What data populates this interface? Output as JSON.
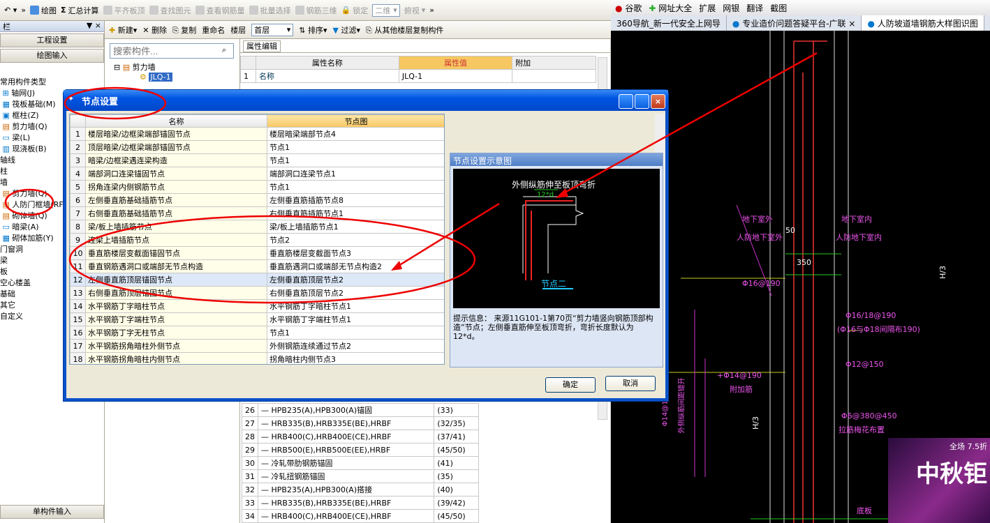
{
  "toolbar": {
    "draw": "绘图",
    "sum": "汇总计算",
    "flat": "平齐板顶",
    "find": "查找图元",
    "view_rebar": "查看钢筋量",
    "batch": "批量选择",
    "rebar3d": "钢筋三维",
    "lock": "锁定",
    "view_mode": "二维",
    "view_angle": "俯视"
  },
  "sidebar": {
    "title": "栏",
    "pin": "▼ ×",
    "btn1": "工程设置",
    "btn2": "绘图输入",
    "bottom": "单构件输入",
    "items": [
      "常用构件类型",
      "轴网(J)",
      "筏板基础(M)",
      "框柱(Z)",
      "剪力墙(Q)",
      "梁(L)",
      "现浇板(B)",
      "轴线",
      "柱",
      "墙",
      "剪力墙(Q)",
      "人防门框墙(RF)",
      "砌体墙(Q)",
      "暗梁(A)",
      "砌体加筋(Y)",
      "门窗洞",
      "梁",
      "板",
      "空心楼盖",
      "基础",
      "其它",
      "自定义"
    ]
  },
  "comp_toolbar": {
    "new": "新建",
    "del": "删除",
    "copy": "复制",
    "rename": "重命名",
    "floor_label": "楼层",
    "floor": "首层",
    "sort": "排序",
    "filter": "过滤",
    "copy_from": "从其他楼层复制构件"
  },
  "search": {
    "placeholder": "搜索构件..."
  },
  "comp_tree": {
    "root": "剪力墙",
    "child": "JLQ-1"
  },
  "prop": {
    "tab": "属性编辑",
    "h_name": "属性名称",
    "h_val": "属性值",
    "h_add": "附加",
    "r1_no": "1",
    "r1_name": "名称",
    "r1_val": "JLQ-1",
    "rows": [
      [
        "26",
        "HPB235(A),HPB300(A)锚固",
        "(33)"
      ],
      [
        "27",
        "HRB335(B),HRB335E(BE),HRBF",
        "(32/35)"
      ],
      [
        "28",
        "HRB400(C),HRB400E(CE),HRBF",
        "(37/41)"
      ],
      [
        "29",
        "HRB500(E),HRB500E(EE),HRBF",
        "(45/50)"
      ],
      [
        "30",
        "冷轧带肋钢筋锚固",
        "(41)"
      ],
      [
        "31",
        "冷轧扭钢筋锚固",
        "(35)"
      ],
      [
        "32",
        "HPB235(A),HPB300(A)搭接",
        "(40)"
      ],
      [
        "33",
        "HRB335(B),HRB335E(BE),HRBF",
        "(39/42)"
      ],
      [
        "34",
        "HRB400(C),HRB400E(CE),HRBF",
        "(45/50)"
      ]
    ]
  },
  "browser": {
    "bar": [
      "谷歌",
      "网址大全",
      "扩展",
      "网银",
      "翻译",
      "截图"
    ],
    "tabs": [
      "360导航_新一代安全上网导",
      "专业造价问题答疑平台-广联",
      "人防坡道墙钢筋大样图识图"
    ]
  },
  "dialog": {
    "title": "节点设置",
    "h_name": "名称",
    "h_node": "节点图",
    "rows": [
      [
        "1",
        "楼层暗梁/边框梁端部锚固节点",
        "楼层暗梁端部节点4"
      ],
      [
        "2",
        "顶层暗梁/边框梁端部锚固节点",
        "节点1"
      ],
      [
        "3",
        "暗梁/边框梁遇连梁构造",
        "节点1"
      ],
      [
        "4",
        "端部洞口连梁锚固节点",
        "端部洞口连梁节点1"
      ],
      [
        "5",
        "拐角连梁内侧钢筋节点",
        "节点1"
      ],
      [
        "6",
        "左侧垂直筋基础插筋节点",
        "左侧垂直筋插筋节点8"
      ],
      [
        "7",
        "右侧垂直筋基础插筋节点",
        "右侧垂直筋插筋节点1"
      ],
      [
        "8",
        "梁/板上墙插筋节点",
        "梁/板上墙插筋节点1"
      ],
      [
        "9",
        "连梁上墙插筋节点",
        "节点2"
      ],
      [
        "10",
        "垂直筋楼层变截面锚固节点",
        "垂直筋楼层变截面节点3"
      ],
      [
        "11",
        "垂直钢筋遇洞口或端部无节点构造",
        "垂直筋遇洞口或端部无节点构造2"
      ],
      [
        "12",
        "左侧垂直筋顶层锚固节点",
        "左侧垂直筋顶层节点2"
      ],
      [
        "13",
        "右侧垂直筋顶层锚固节点",
        "右侧垂直筋顶层节点2"
      ],
      [
        "14",
        "水平钢筋丁字暗柱节点",
        "水平钢筋丁字暗柱节点1"
      ],
      [
        "15",
        "水平钢筋丁字端柱节点",
        "水平钢筋丁字端柱节点1"
      ],
      [
        "16",
        "水平钢筋丁字无柱节点",
        "节点1"
      ],
      [
        "17",
        "水平钢筋拐角暗柱外侧节点",
        "外侧钢筋连续通过节点2"
      ],
      [
        "18",
        "水平钢筋拐角暗柱内侧节点",
        "拐角暗柱内侧节点3"
      ]
    ],
    "preview_title": "节点设置示意图",
    "preview_caption": "外侧纵筋伸至板顶弯折",
    "preview_dim": "12*d",
    "preview_node": "节点二",
    "tip": "提示信息：  来源11G101-1第70页“剪力墙竖向钢筋顶部构造”节点；左侧垂直筋伸至板顶弯折，弯折长度默认为12*d。",
    "ok": "确定",
    "cancel": "取消"
  },
  "cad": {
    "t1": "地下室外",
    "t2": "人防地下室外",
    "t3": "地下室内",
    "t4": "人防地下室内",
    "t5": "50",
    "t6": "350",
    "t7": "H/3",
    "t8": "Φ16@190",
    "t9": "Φ16/18@190",
    "t10": "(Φ16与Φ18间隔布190)",
    "t11": "Φ12@150",
    "t12": "+Φ14@190",
    "t13": "附加筋",
    "t14": "Φ6@380@450",
    "t15": "拉筋梅花布置",
    "t16": "H/3",
    "t17": "Φ14@190附加筋",
    "t18": "外侧纵筋间距错开",
    "t19": "底板"
  },
  "ad": {
    "line1": "全场 7.5折",
    "big": "中秋钜"
  }
}
